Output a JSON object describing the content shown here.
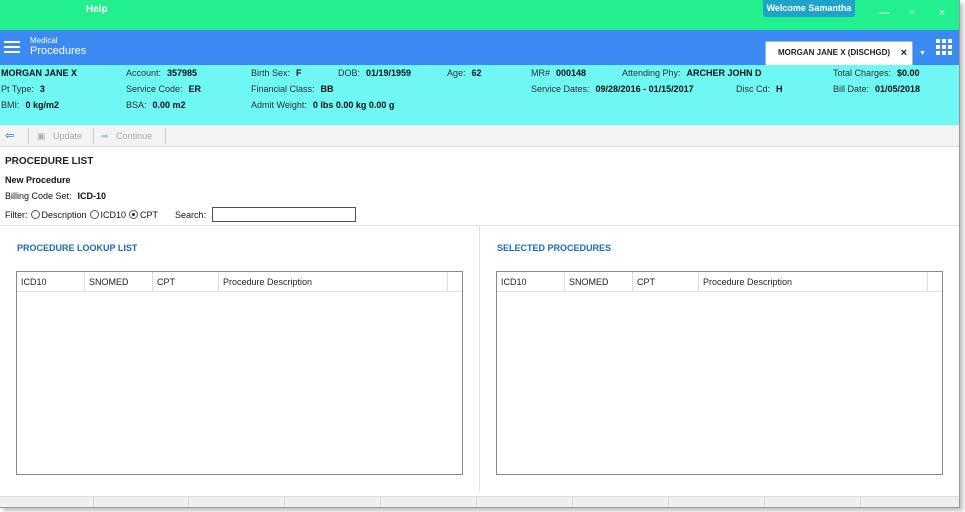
{
  "titlebar": {
    "app_title": "Help",
    "user": "Welcome Samantha",
    "minimize_icon": "minimize-icon",
    "restore_icon": "restore-icon",
    "close_icon": "close-icon"
  },
  "header": {
    "module_small": "Medical",
    "module_title": "Procedures",
    "patient_tab": "MORGAN JANE X (DISCHGD)",
    "tab_close": "×",
    "tab_dropdown": "▼"
  },
  "banner": {
    "patient_name": "MORGAN JANE X",
    "account_label": "Account:",
    "account": "357985",
    "birth_sex_label": "Birth Sex:",
    "birth_sex": "F",
    "dob_label": "DOB:",
    "dob": "01/19/1959",
    "age_label": "Age:",
    "age": "62",
    "mr_label": "MR#",
    "mr": "000148",
    "attending_label": "Attending Phy:",
    "attending": "ARCHER JOHN D",
    "total_charges_label": "Total Charges:",
    "total_charges": "$0.00",
    "pt_type_label": "Pt Type:",
    "pt_type": "3",
    "service_code_label": "Service Code:",
    "service_code": "ER",
    "financial_class_label": "Financial Class:",
    "financial_class": "BB",
    "service_dates_label": "Service Dates:",
    "service_dates": "09/28/2016 - 01/15/2017",
    "disc_cd_label": "Disc Cd:",
    "disc_cd": "H",
    "bill_date_label": "Bill Date:",
    "bill_date": "01/05/2018",
    "bmi_label": "BMI:",
    "bmi": "0 kg/m2",
    "bsa_label": "BSA:",
    "bsa": "0.00 m2",
    "admit_weight_label": "Admit Weight:",
    "admit_weight": "0 lbs 0.00 kg 0.00 g"
  },
  "toolbar": {
    "back_icon": "back-arrow-icon",
    "update": "Update",
    "continue": "Continue"
  },
  "content": {
    "section_title": "PROCEDURE LIST",
    "new_procedure": "New Procedure",
    "billing_label": "Billing Code Set:",
    "billing_value": "ICD-10",
    "filter_label": "Filter:",
    "filter_options": [
      "Description",
      "ICD10",
      "CPT"
    ],
    "filter_selected": "CPT",
    "search_label": "Search:",
    "search_value": ""
  },
  "lookup": {
    "title": "PROCEDURE LOOKUP LIST",
    "columns": [
      "ICD10",
      "SNOMED",
      "CPT",
      "Procedure Description"
    ]
  },
  "selected": {
    "title": "SELECTED PROCEDURES",
    "columns": [
      "ICD10",
      "SNOMED",
      "CPT",
      "Procedure Description"
    ]
  },
  "colors": {
    "titlebar": "#22f08e",
    "header": "#3b8af3",
    "banner": "#6ef7f3",
    "panel_title": "#1a6bb5"
  }
}
